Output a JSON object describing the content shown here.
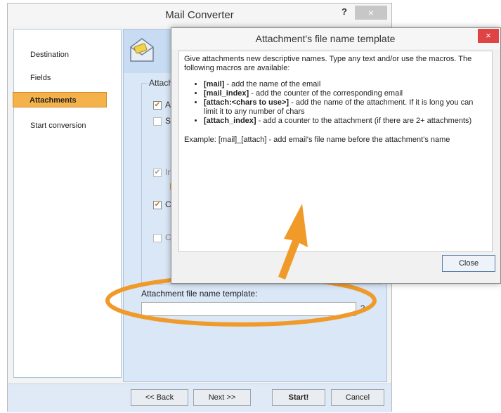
{
  "main": {
    "title": "Mail Converter",
    "help": "?",
    "close": "×",
    "nav": [
      "Destination",
      "Fields",
      "Attachments",
      "Start conversion"
    ],
    "group_label": "Attach",
    "rows": [
      {
        "text": "A"
      },
      {
        "text": "S"
      },
      {
        "text": "In"
      },
      {
        "text": "C"
      },
      {
        "text": "C"
      }
    ],
    "template_label": "Attachment file name template:",
    "template_help": "?",
    "buttons": {
      "back": "<< Back",
      "next": "Next >>",
      "start": "Start!",
      "cancel": "Cancel"
    }
  },
  "dialog": {
    "title": "Attachment's file name template",
    "close": "×",
    "intro": "Give attachments new descriptive names. Type any text and/or use the macros. The following macros are available:",
    "macros": [
      {
        "name": "[mail]",
        "desc": " - add the name of the email"
      },
      {
        "name": "[mail_index]",
        "desc": " - add the counter of the corresponding email"
      },
      {
        "name": "[attach:<chars to use>]",
        "desc": " - add the name of the attachment. If it is long you can limit it to any number of chars"
      },
      {
        "name": "[attach_index]",
        "desc": " - add a counter to the attachment (if there are 2+ attachments)"
      }
    ],
    "example": "Example: [mail]_[attach] - add email's file name before the attachment's name",
    "close_button": "Close"
  },
  "colors": {
    "accent": "#f5b24a",
    "annotation": "#f09a2a"
  }
}
